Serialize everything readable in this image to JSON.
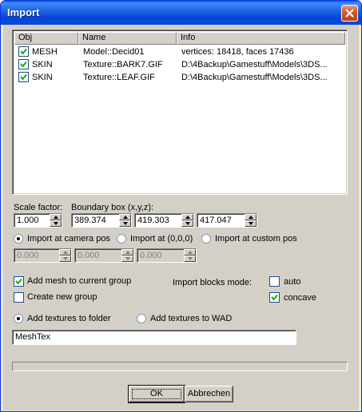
{
  "window": {
    "title": "Import"
  },
  "list": {
    "columns": [
      "Obj",
      "Name",
      "Info"
    ],
    "rows": [
      {
        "checked": true,
        "obj": "MESH",
        "name": "Model::Decid01",
        "info": "vertices: 18418, faces 17436"
      },
      {
        "checked": true,
        "obj": "SKIN",
        "name": "Texture::BARK7.GIF",
        "info": "D:\\4Backup\\Gamestuff\\Models\\3DS..."
      },
      {
        "checked": true,
        "obj": "SKIN",
        "name": "Texture::LEAF.GIF",
        "info": "D:\\4Backup\\Gamestuff\\Models\\3DS..."
      }
    ]
  },
  "scale": {
    "label": "Scale factor:",
    "value": "1.000"
  },
  "bbox": {
    "label": "Boundary box (x,y,z):",
    "x": "389.374",
    "y": "419.303",
    "z": "417.047"
  },
  "import_pos": {
    "options": [
      "Import at camera pos",
      "Import at (0,0,0)",
      "Import at custom pos"
    ],
    "selected": 0,
    "custom": [
      "0.000",
      "0.000",
      "0.000"
    ]
  },
  "group": {
    "add_to_current": {
      "label": "Add mesh to current group",
      "checked": true
    },
    "create_new": {
      "label": "Create new group",
      "checked": false
    }
  },
  "blocks_mode": {
    "label": "Import blocks mode:",
    "auto": {
      "label": "auto",
      "checked": false
    },
    "concave": {
      "label": "concave",
      "checked": true
    }
  },
  "textures": {
    "options": [
      "Add textures to folder",
      "Add textures to WAD"
    ],
    "selected": 0,
    "folder": "MeshTex"
  },
  "buttons": {
    "ok": "OK",
    "cancel": "Abbrechen"
  },
  "colors": {
    "titlebar": "#0a49d7",
    "dialog": "#d4d0c8",
    "checkbox_border": "#1c5180"
  }
}
